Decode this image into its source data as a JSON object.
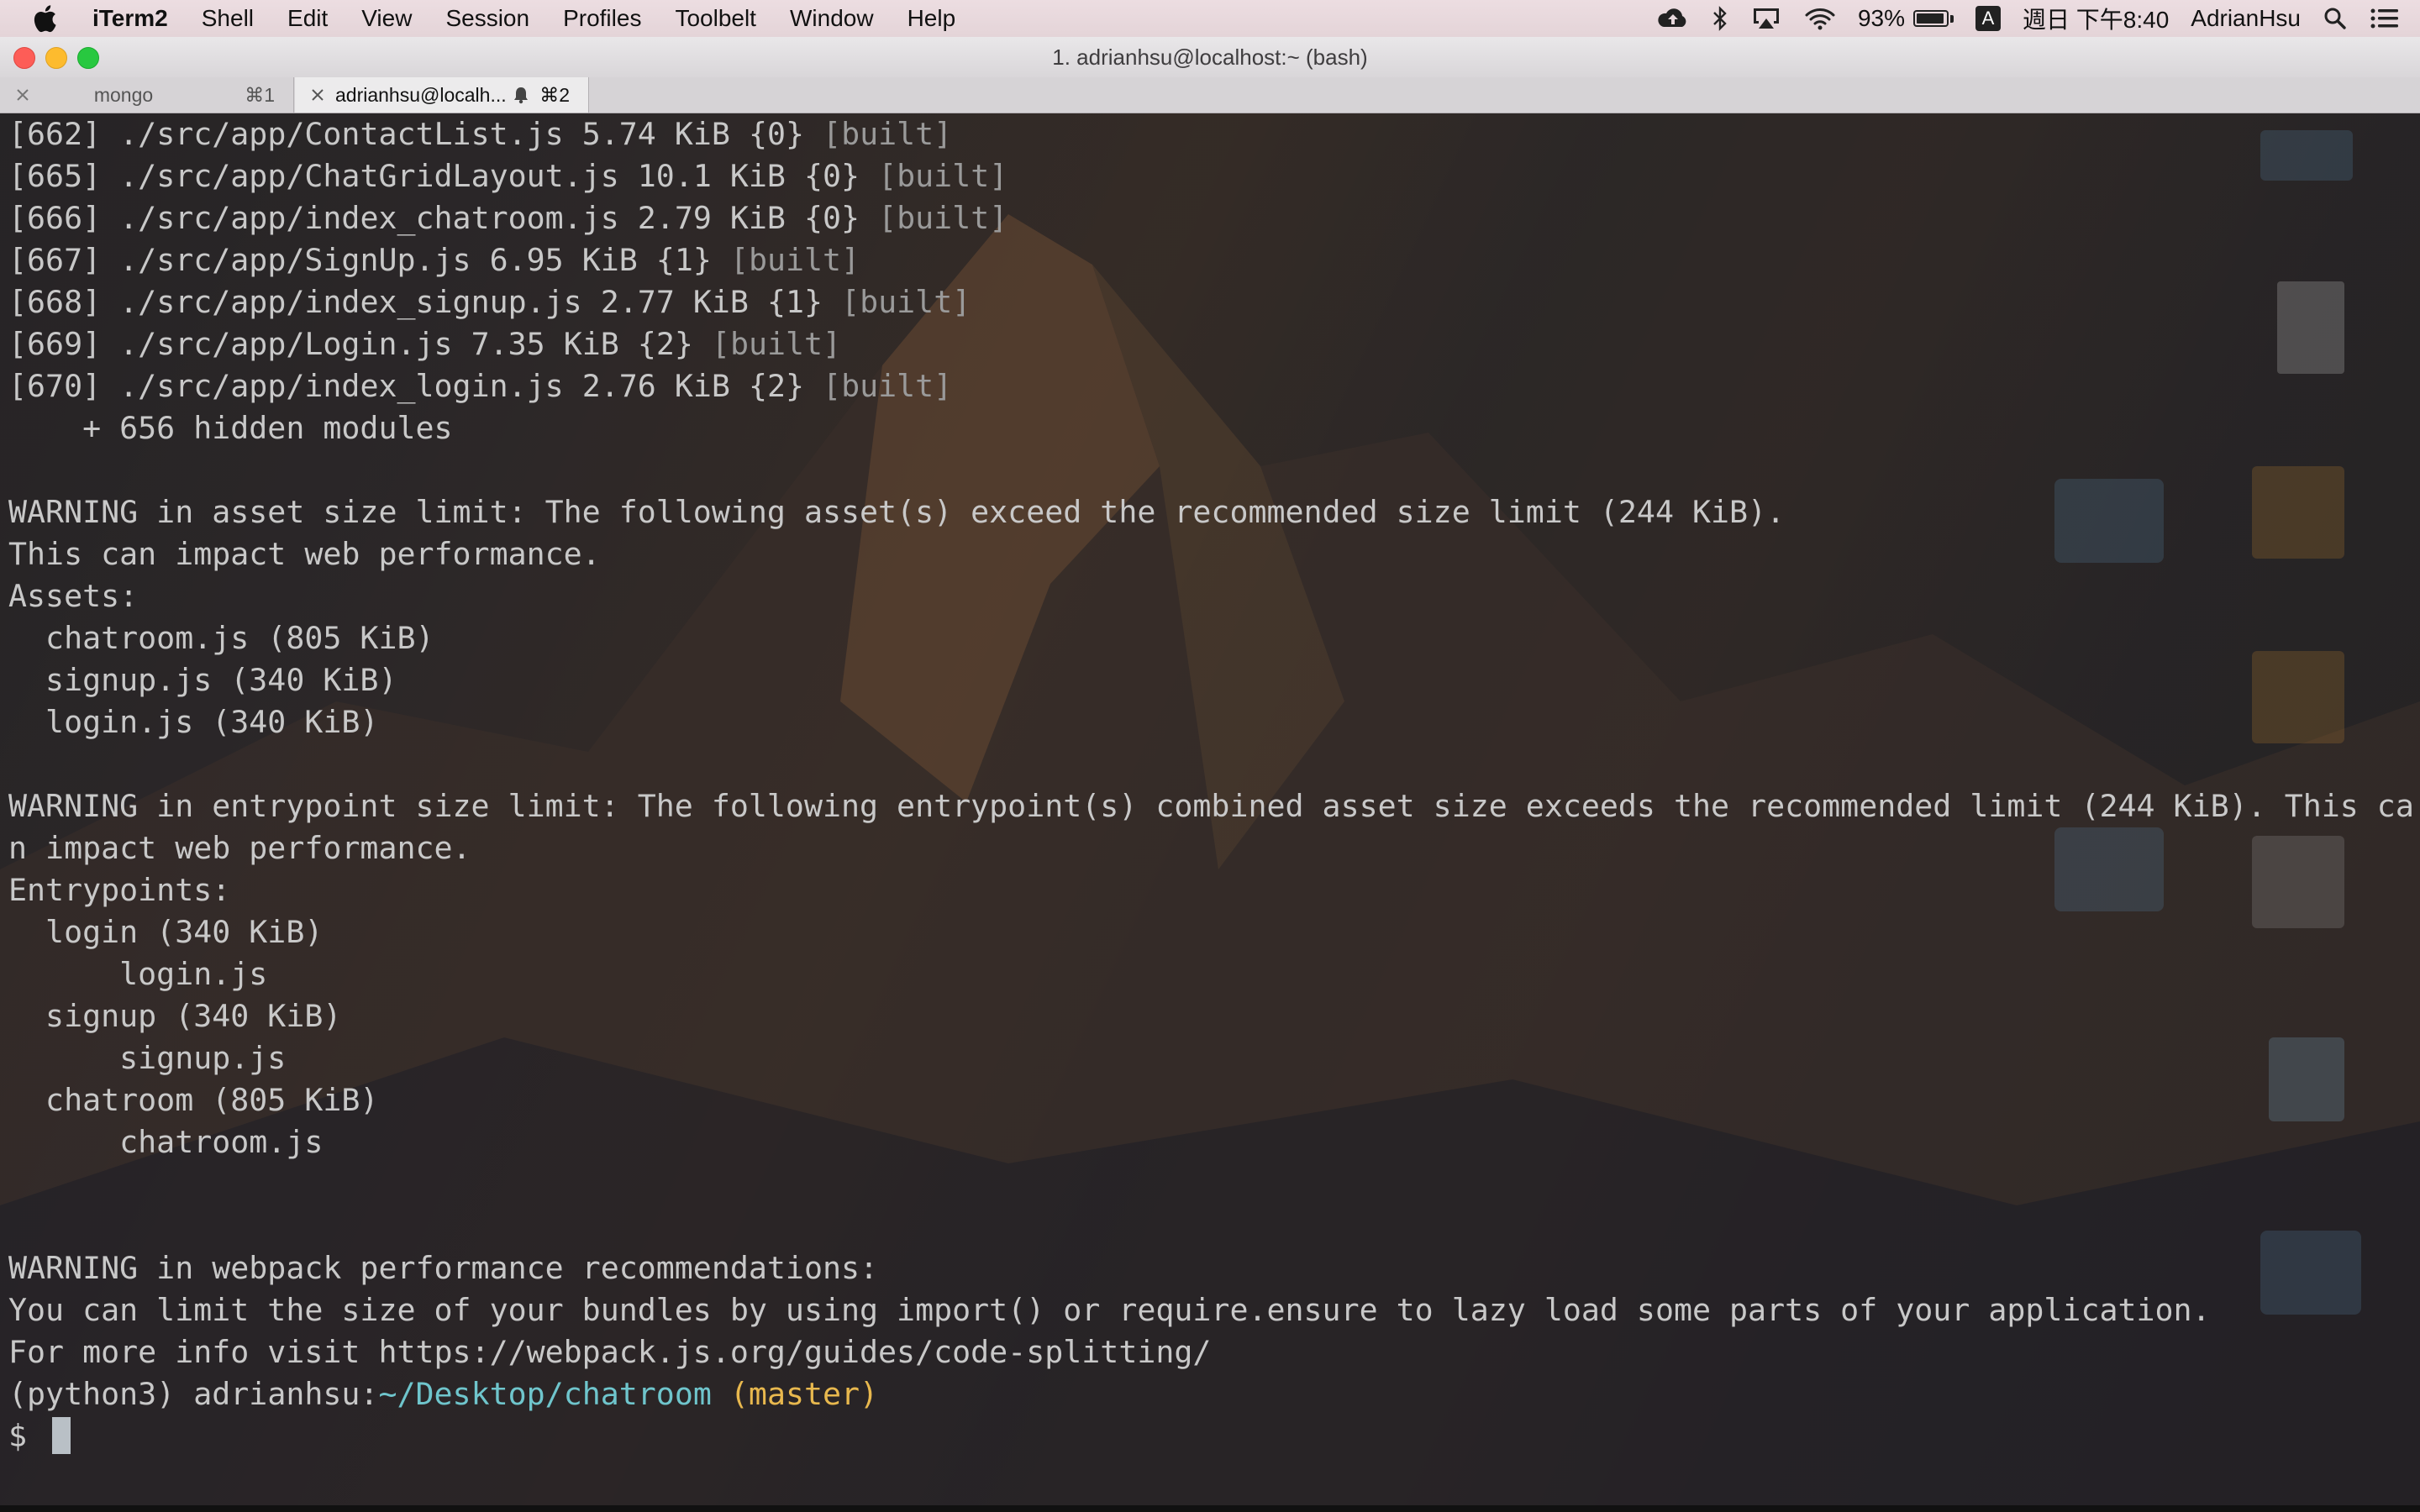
{
  "menubar": {
    "app_name": "iTerm2",
    "items": [
      "Shell",
      "Edit",
      "View",
      "Session",
      "Profiles",
      "Toolbelt",
      "Window",
      "Help"
    ],
    "status": {
      "battery": "93%",
      "battery_level": 0.93,
      "input_method": "A",
      "clock": "週日 下午8:40",
      "user": "AdrianHsu"
    }
  },
  "window": {
    "title": "1. adrianhsu@localhost:~ (bash)"
  },
  "tabs": [
    {
      "label": "mongo",
      "shortcut": "⌘1"
    },
    {
      "label": "adrianhsu@localh...",
      "shortcut": "⌘2"
    }
  ],
  "terminal": {
    "modules": [
      {
        "id": "[662]",
        "path": "./src/app/ContactList.js",
        "size": "5.74 KiB",
        "chunk": "{0}",
        "status": "[built]"
      },
      {
        "id": "[665]",
        "path": "./src/app/ChatGridLayout.js",
        "size": "10.1 KiB",
        "chunk": "{0}",
        "status": "[built]"
      },
      {
        "id": "[666]",
        "path": "./src/app/index_chatroom.js",
        "size": "2.79 KiB",
        "chunk": "{0}",
        "status": "[built]"
      },
      {
        "id": "[667]",
        "path": "./src/app/SignUp.js",
        "size": "6.95 KiB",
        "chunk": "{1}",
        "status": "[built]"
      },
      {
        "id": "[668]",
        "path": "./src/app/index_signup.js",
        "size": "2.77 KiB",
        "chunk": "{1}",
        "status": "[built]"
      },
      {
        "id": "[669]",
        "path": "./src/app/Login.js",
        "size": "7.35 KiB",
        "chunk": "{2}",
        "status": "[built]"
      },
      {
        "id": "[670]",
        "path": "./src/app/index_login.js",
        "size": "2.76 KiB",
        "chunk": "{2}",
        "status": "[built]"
      }
    ],
    "hidden_modules": "    + 656 hidden modules",
    "asset_warning": [
      "WARNING in asset size limit: The following asset(s) exceed the recommended size limit (244 KiB).",
      "This can impact web performance.",
      "Assets:",
      "  chatroom.js (805 KiB)",
      "  signup.js (340 KiB)",
      "  login.js (340 KiB)"
    ],
    "entry_warning": [
      "WARNING in entrypoint size limit: The following entrypoint(s) combined asset size exceeds the recommended limit (244 KiB). This ca",
      "n impact web performance.",
      "Entrypoints:",
      "  login (340 KiB)",
      "      login.js",
      "  signup (340 KiB)",
      "      signup.js",
      "  chatroom (805 KiB)",
      "      chatroom.js"
    ],
    "perf_warning": [
      "WARNING in webpack performance recommendations:",
      "You can limit the size of your bundles by using import() or require.ensure to lazy load some parts of your application.",
      "For more info visit https://webpack.js.org/guides/code-splitting/"
    ],
    "prompt": {
      "env": "(python3) ",
      "user": "adrianhsu:",
      "path": "~/Desktop/chatroom",
      "branch": " (master)",
      "symbol": "$ "
    }
  },
  "colors": {
    "text": "#c8c8c8",
    "dim": "#9a9a9a",
    "path": "#6fc5cc",
    "branch": "#e8b84e"
  }
}
